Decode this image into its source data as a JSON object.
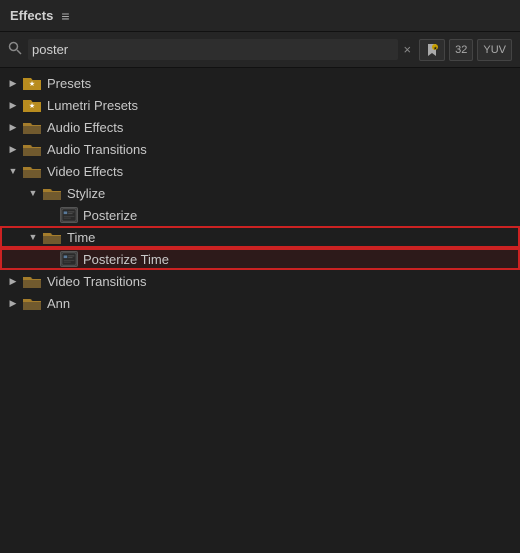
{
  "header": {
    "title": "Effects",
    "menu_icon": "≡"
  },
  "search": {
    "placeholder": "Search",
    "value": "poster",
    "clear_label": "×"
  },
  "toolbar": {
    "icon1": "🔖",
    "icon2": "32",
    "icon3": "YUV"
  },
  "tree": [
    {
      "id": "presets",
      "label": "Presets",
      "level": 0,
      "type": "star-folder",
      "expanded": false,
      "chevron": "▶"
    },
    {
      "id": "lumetri",
      "label": "Lumetri Presets",
      "level": 0,
      "type": "star-folder",
      "expanded": false,
      "chevron": "▶"
    },
    {
      "id": "audio-effects",
      "label": "Audio Effects",
      "level": 0,
      "type": "folder",
      "expanded": false,
      "chevron": "▶"
    },
    {
      "id": "audio-transitions",
      "label": "Audio Transitions",
      "level": 0,
      "type": "folder",
      "expanded": false,
      "chevron": "▶"
    },
    {
      "id": "video-effects",
      "label": "Video Effects",
      "level": 0,
      "type": "folder",
      "expanded": true,
      "chevron": "▼"
    },
    {
      "id": "stylize",
      "label": "Stylize",
      "level": 1,
      "type": "folder",
      "expanded": true,
      "chevron": "▼"
    },
    {
      "id": "posterize",
      "label": "Posterize",
      "level": 2,
      "type": "effect",
      "expanded": false,
      "chevron": ""
    },
    {
      "id": "time",
      "label": "Time",
      "level": 1,
      "type": "folder",
      "expanded": true,
      "chevron": "▼",
      "highlight": true
    },
    {
      "id": "posterize-time",
      "label": "Posterize Time",
      "level": 2,
      "type": "effect",
      "expanded": false,
      "chevron": "",
      "highlight": true
    },
    {
      "id": "video-transitions",
      "label": "Video Transitions",
      "level": 0,
      "type": "folder",
      "expanded": false,
      "chevron": "▶"
    },
    {
      "id": "ann",
      "label": "Ann",
      "level": 0,
      "type": "folder",
      "expanded": false,
      "chevron": "▶"
    }
  ]
}
